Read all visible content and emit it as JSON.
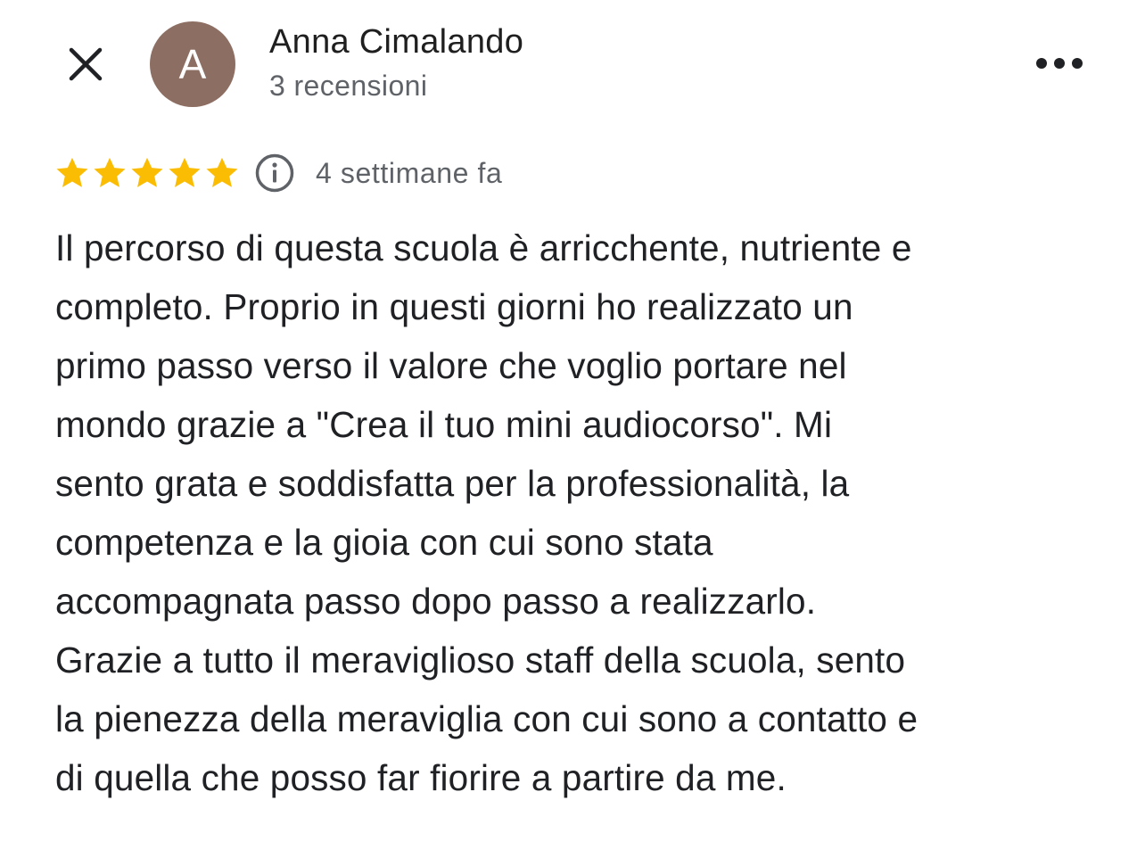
{
  "header": {
    "close_icon": "close-icon",
    "avatar_letter": "A",
    "avatar_color": "#8d6e63",
    "user_name": "Anna Cimalando",
    "user_reviews": "3 recensioni",
    "more_icon": "more-horizontal-icon"
  },
  "rating": {
    "stars": 5,
    "max_stars": 5,
    "star_color": "#fbbc04",
    "info_icon": "info-icon",
    "time_ago": "4 settimane fa"
  },
  "review": {
    "lines": [
      "Il percorso di questa scuola è arricchente, nutriente e",
      "completo. Proprio in questi giorni ho realizzato un",
      "primo passo verso il valore che voglio portare nel",
      "mondo grazie a \"Crea il tuo mini audiocorso\". Mi",
      "sento grata e soddisfatta per la professionalità, la",
      "competenza e la gioia con cui sono stata",
      "accompagnata passo dopo passo a realizzarlo.",
      "Grazie a tutto il meraviglioso staff della scuola, sento",
      "la pienezza della meraviglia con cui sono a contatto e",
      "di quella che posso far fiorire a partire da me."
    ]
  }
}
